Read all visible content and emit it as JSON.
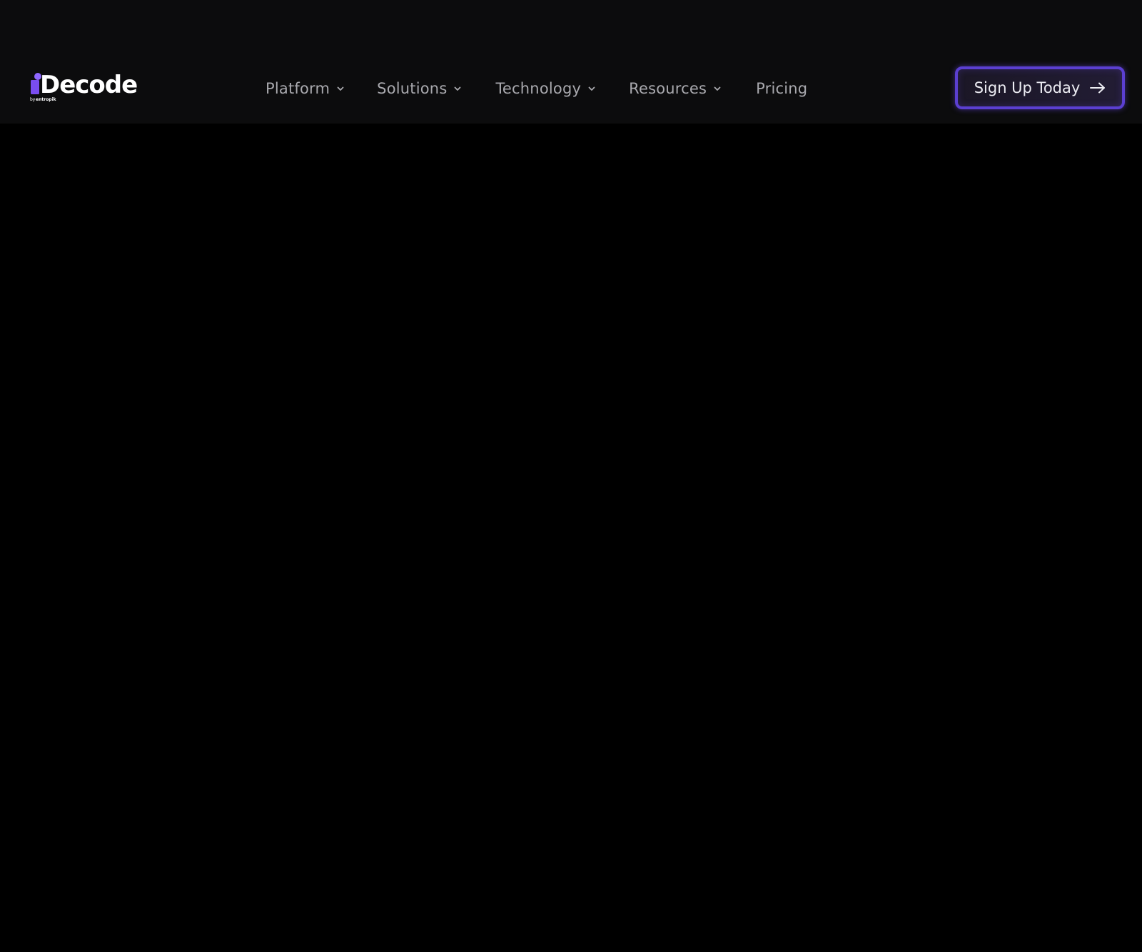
{
  "brand": {
    "logo_text": "iDecode",
    "logo_tagline": "by entropik",
    "accent_color": "#6c4aee"
  },
  "nav": {
    "items": [
      {
        "label": "Platform",
        "icon": "chevron-down-icon"
      },
      {
        "label": "Solutions",
        "icon": "chevron-down-icon"
      },
      {
        "label": "Technology",
        "icon": "chevron-down-icon"
      },
      {
        "label": "Resources",
        "icon": "chevron-down-icon"
      },
      {
        "label": "Pricing"
      }
    ]
  },
  "cta": {
    "label": "Sign Up Today",
    "icon": "arrow-right-icon"
  }
}
